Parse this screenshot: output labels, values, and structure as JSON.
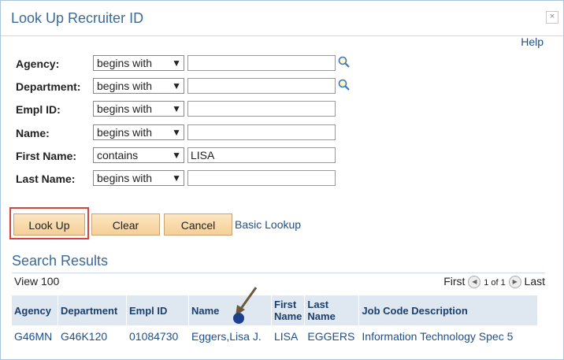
{
  "window": {
    "title": "Look Up Recruiter ID",
    "close_label": "×",
    "help_label": "Help"
  },
  "criteria": [
    {
      "label": "Agency:",
      "operator": "begins with",
      "value": "",
      "has_lookup": true
    },
    {
      "label": "Department:",
      "operator": "begins with",
      "value": "",
      "has_lookup": true
    },
    {
      "label": "Empl ID:",
      "operator": "begins with",
      "value": "",
      "has_lookup": false
    },
    {
      "label": "Name:",
      "operator": "begins with",
      "value": "",
      "has_lookup": false
    },
    {
      "label": "First Name:",
      "operator": "contains",
      "value": "LISA",
      "has_lookup": false
    },
    {
      "label": "Last Name:",
      "operator": "begins with",
      "value": "",
      "has_lookup": false
    }
  ],
  "buttons": {
    "lookup": "Look Up",
    "clear": "Clear",
    "cancel": "Cancel",
    "basic": "Basic Lookup"
  },
  "results": {
    "title": "Search Results",
    "view": "View 100",
    "pager": {
      "first": "First",
      "count": "1 of 1",
      "last": "Last"
    },
    "columns": [
      "Agency",
      "Department",
      "Empl ID",
      "Name",
      "First Name",
      "Last Name",
      "Job Code Description"
    ],
    "rows": [
      [
        "G46MN",
        "G46K120",
        "01084730",
        "Eggers,Lisa J.",
        "LISA",
        "EGGERS",
        "Information Technology Spec 5"
      ]
    ]
  }
}
